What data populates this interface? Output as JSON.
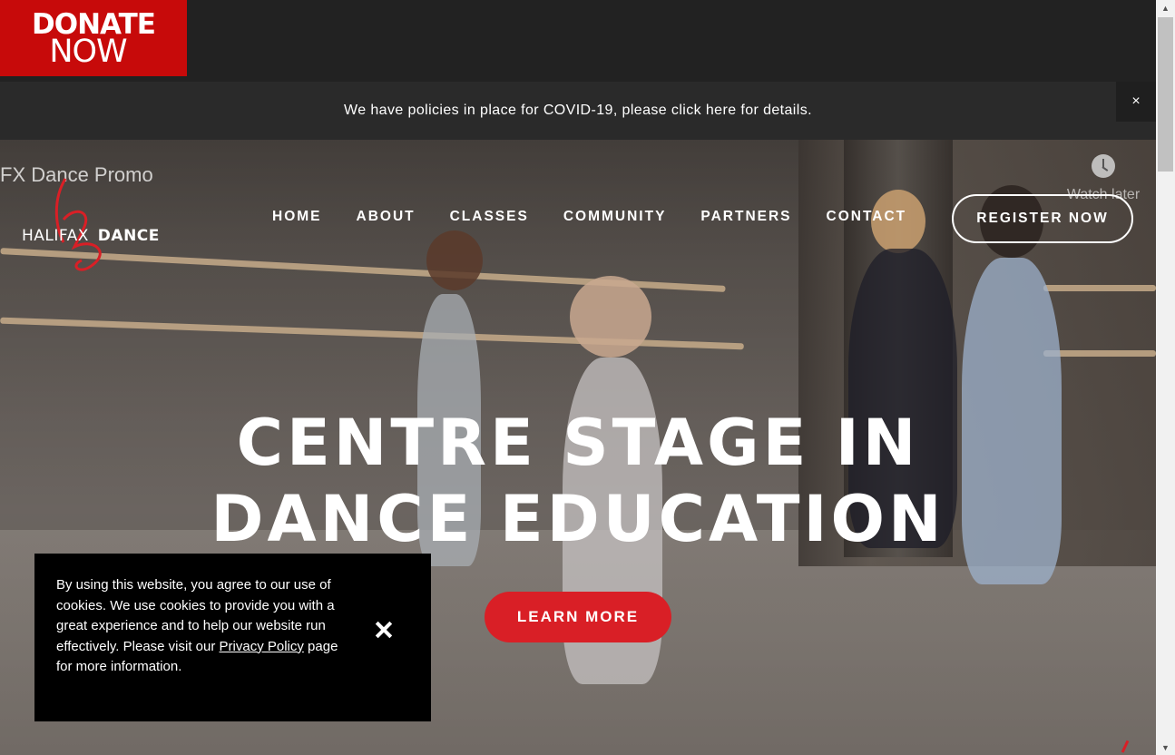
{
  "donate": {
    "line1": "DONATE",
    "line2": "NOW"
  },
  "covid_bar": {
    "message": "We have policies in place for COVID-19, please click here for details.",
    "close_label": "×"
  },
  "video": {
    "title": "FX Dance Promo",
    "watch_later_label": "Watch later",
    "watch_later_icon": "clock-icon"
  },
  "logo": {
    "word1": "HALIFAX",
    "word2": "DANCE",
    "accent_color": "#d91f26"
  },
  "nav": {
    "items": [
      {
        "label": "HOME"
      },
      {
        "label": "ABOUT"
      },
      {
        "label": "CLASSES"
      },
      {
        "label": "COMMUNITY"
      },
      {
        "label": "PARTNERS"
      },
      {
        "label": "CONTACT"
      }
    ],
    "register_label": "REGISTER NOW"
  },
  "hero": {
    "headline_line1": "CENTRE STAGE IN",
    "headline_line2": "DANCE EDUCATION",
    "cta_label": "LEARN MORE",
    "cta_color": "#d91f26"
  },
  "cookie": {
    "text_before": "By using this website, you agree to our use of cookies. We use cookies to provide you with a great experience and to help our website run effectively. Please visit our ",
    "link_label": "Privacy Policy",
    "text_after": " page for more information.",
    "close_icon": "close-icon"
  },
  "colors": {
    "donate_bg": "#c70a0a",
    "topbar_bg": "#222222",
    "cookie_bg": "#000000"
  }
}
